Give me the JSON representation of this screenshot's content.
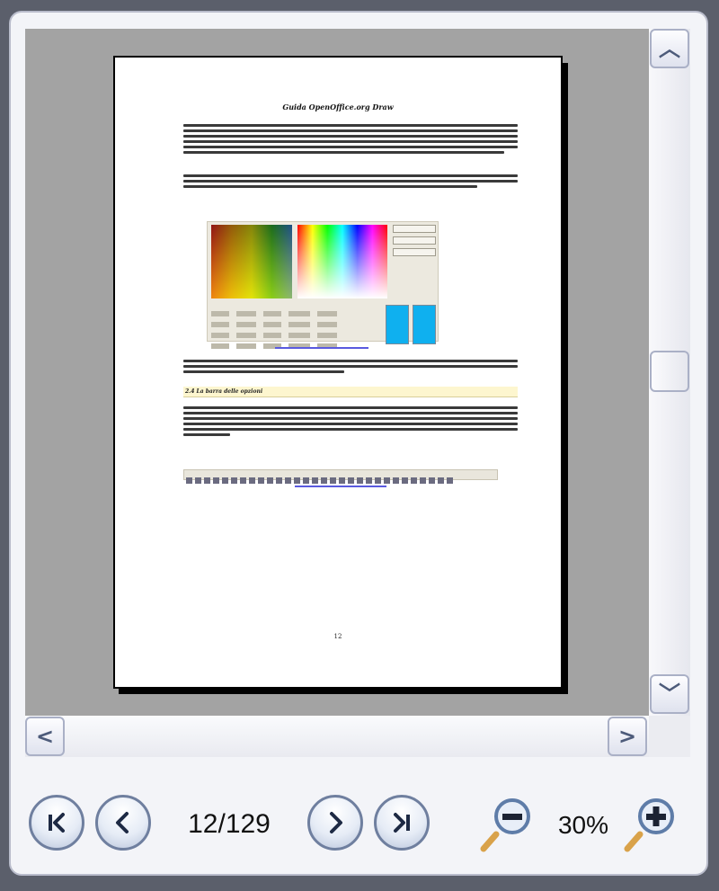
{
  "document": {
    "title": "Guida OpenOffice.org Draw",
    "section_heading": "2.4 La barra delle opzioni",
    "page_number_label": "12"
  },
  "navigation": {
    "first_page_icon": "first-page-icon",
    "prev_page_icon": "previous-page-icon",
    "next_page_icon": "next-page-icon",
    "last_page_icon": "last-page-icon",
    "page_counter": "12/129"
  },
  "zoom": {
    "level": "30%",
    "zoom_out_icon": "zoom-out-icon",
    "zoom_in_icon": "zoom-in-icon"
  },
  "scrollbars": {
    "up_glyph": "︿",
    "down_glyph": "﹀",
    "left_glyph": "<",
    "right_glyph": ">"
  },
  "colors": {
    "viewport_bg": "#a3a3a3",
    "button_border": "#6f7f9f",
    "swatch_color": "#0fb0ef"
  }
}
